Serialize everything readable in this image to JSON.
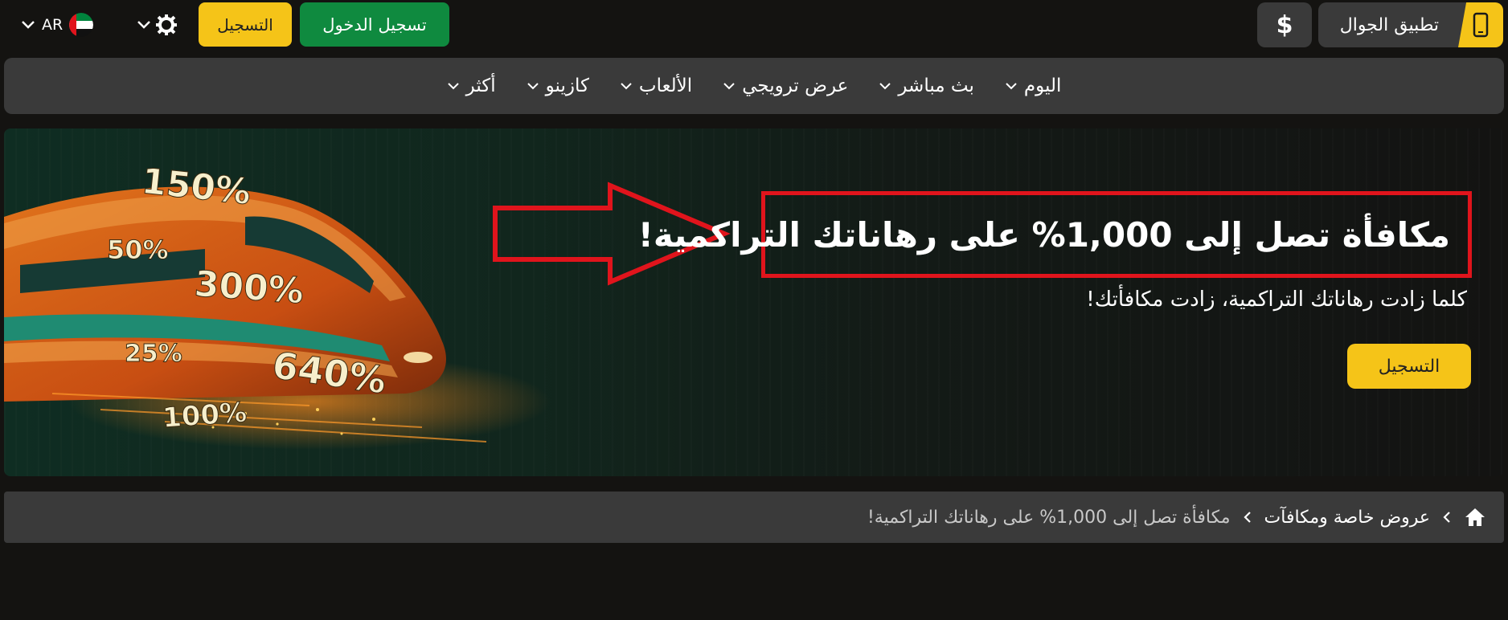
{
  "topbar": {
    "app_button_label": "تطبيق الجوال",
    "currency_symbol": "$",
    "login_label": "تسجيل الدخول",
    "register_label": "التسجيل",
    "language_code": "AR"
  },
  "nav": {
    "items": [
      {
        "label": "اليوم"
      },
      {
        "label": "بث مباشر"
      },
      {
        "label": "عرض ترويجي"
      },
      {
        "label": "الألعاب"
      },
      {
        "label": "كازينو"
      },
      {
        "label": "أكثر"
      }
    ]
  },
  "hero": {
    "headline": "مكافأة تصل إلى 1,000% على رهاناتك التراكمية!",
    "subline": "كلما زادت رهاناتك التراكمية، زادت مكافأتك!",
    "register_label": "التسجيل",
    "percent_labels": [
      "150%",
      "50%",
      "300%",
      "25%",
      "640%",
      "100%"
    ]
  },
  "breadcrumb": {
    "section_label": "عروض خاصة ومكافآت",
    "current_label": "مكافأة تصل إلى 1,000% على رهاناتك التراكمية!"
  },
  "colors": {
    "accent_yellow": "#f5c418",
    "login_green": "#0f8a3f",
    "annotation_red": "#e0141c",
    "panel_gray": "#3a3a3a"
  }
}
